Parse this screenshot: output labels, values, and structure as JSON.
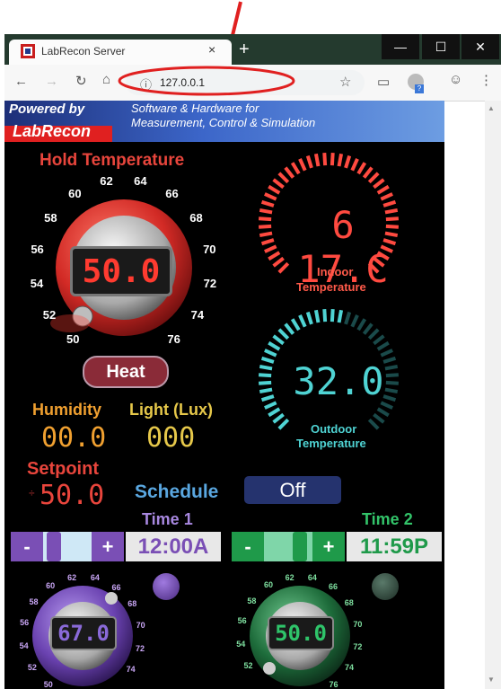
{
  "browser": {
    "tab_title": "LabRecon Server",
    "tab_close": "×",
    "new_tab": "+",
    "url": "127.0.0.1",
    "win_minimize": "—",
    "win_maximize": "☐",
    "win_close": "✕"
  },
  "banner": {
    "powered_by": "Powered by",
    "brand": "LabRecon",
    "tagline_line1": "Software & Hardware for",
    "tagline_line2": "Measurement, Control & Simulation"
  },
  "hold": {
    "title": "Hold Temperature",
    "value": "50.0",
    "ticks": [
      "50",
      "52",
      "54",
      "56",
      "58",
      "60",
      "62",
      "64",
      "66",
      "68",
      "70",
      "72",
      "74",
      "76"
    ],
    "mode_button": "Heat"
  },
  "indoor": {
    "value": "61.7C",
    "value_display": "6 17.C",
    "label1": "Indoor",
    "label2": "Temperature"
  },
  "outdoor": {
    "value": "32.0",
    "label1": "Outdoor",
    "label2": "Temperature"
  },
  "humidity": {
    "label": "Humidity",
    "value": "00.0"
  },
  "light": {
    "label": "Light (Lux)",
    "value": "000"
  },
  "setpoint": {
    "label": "Setpoint",
    "value": "50.0"
  },
  "schedule": {
    "label": "Schedule",
    "state": "Off"
  },
  "time1": {
    "label": "Time 1",
    "minus": "-",
    "plus": "+",
    "value": "12:00A",
    "knob_value": "67.0",
    "ticks": [
      "50",
      "52",
      "54",
      "56",
      "58",
      "60",
      "62",
      "64",
      "66",
      "68",
      "70",
      "72",
      "74"
    ]
  },
  "time2": {
    "label": "Time 2",
    "minus": "-",
    "plus": "+",
    "value": "11:59P",
    "knob_value": "50.0",
    "ticks": [
      "52",
      "54",
      "56",
      "58",
      "60",
      "62",
      "64",
      "66",
      "68",
      "70",
      "72",
      "74",
      "76"
    ]
  },
  "colors": {
    "red": "#e8453c",
    "orange": "#f0a030",
    "yellow": "#e6c84a",
    "cyan": "#4fd3d3",
    "purple": "#8a5cc8",
    "green": "#1f9a4a",
    "blue_sched": "#5aa7e0"
  }
}
